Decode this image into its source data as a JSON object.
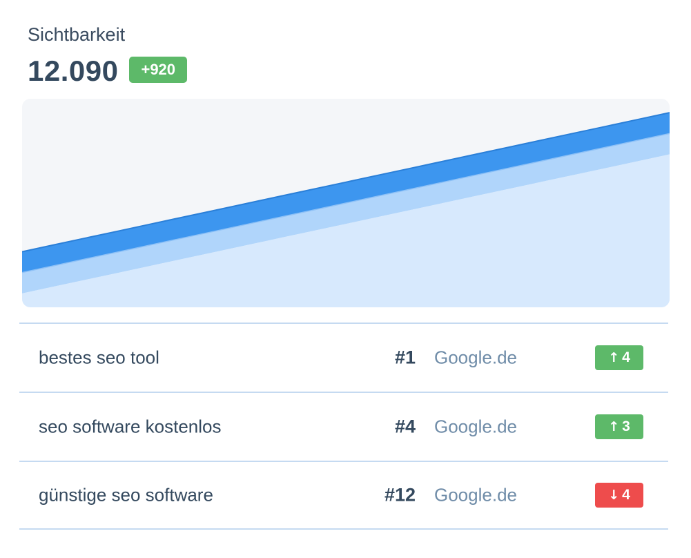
{
  "header": {
    "label": "Sichtbarkeit",
    "value": "12.090",
    "change": "+920"
  },
  "colors": {
    "positive": "#5db969",
    "negative": "#ee4c4c",
    "chart_background": "#f4f6f9",
    "series_top_fill": "#3d96ef",
    "series_top_stroke": "#2a7fd8",
    "series_mid_fill": "#b0d5fb",
    "series_mid_stroke": "#8ec1f6",
    "series_bottom_fill": "#d7e9fd"
  },
  "chart_data": {
    "type": "area",
    "stacked": true,
    "x": [
      0,
      1,
      2,
      3,
      4,
      5,
      6,
      7,
      8,
      9,
      10,
      11,
      12,
      13,
      14,
      15,
      16,
      17,
      18,
      19,
      20
    ],
    "series": [
      {
        "values": [
          2,
          3,
          4,
          5,
          6,
          7,
          8,
          9,
          10,
          11,
          12,
          13,
          14,
          15,
          16,
          17,
          18,
          19,
          20,
          21,
          22
        ]
      },
      {
        "values": [
          3,
          3,
          3,
          3,
          3,
          3,
          3,
          3,
          3,
          3,
          3,
          3,
          3,
          3,
          3,
          3,
          3,
          3,
          3,
          3,
          3
        ]
      },
      {
        "values": [
          3,
          3,
          3,
          3,
          3,
          3,
          3,
          3,
          3,
          3,
          3,
          3,
          3,
          3,
          3,
          3,
          3,
          3,
          3,
          3,
          3
        ]
      }
    ],
    "grid": false,
    "legend": "none"
  },
  "keywords": [
    {
      "keyword": "bestes seo tool",
      "rank": "#1",
      "engine": "Google.de",
      "direction": "up",
      "arrow": "↑",
      "change": "4"
    },
    {
      "keyword": "seo software kostenlos",
      "rank": "#4",
      "engine": "Google.de",
      "direction": "up",
      "arrow": "↑",
      "change": "3"
    },
    {
      "keyword": "günstige seo software",
      "rank": "#12",
      "engine": "Google.de",
      "direction": "down",
      "arrow": "↓",
      "change": "4"
    }
  ]
}
